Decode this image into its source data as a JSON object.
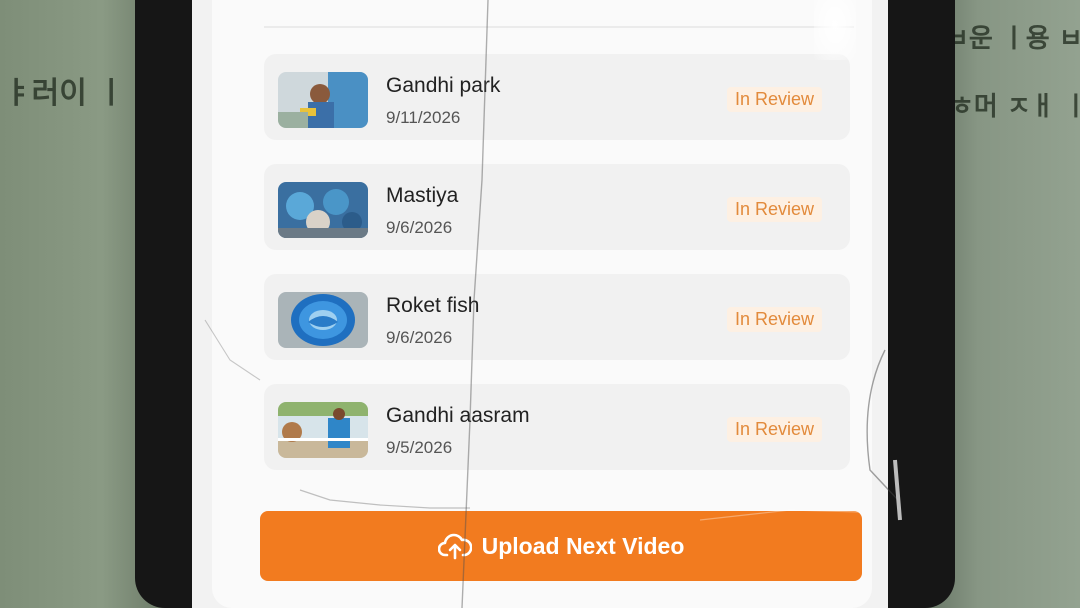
{
  "background": {
    "left_text": "ㅑ러이 ㅣ",
    "right_text_1": "ㅂ운 ㅣ용 ㅂ",
    "right_text_2": "ㅎ머 ㅈㅐ ㅣ"
  },
  "videos": [
    {
      "title": "Gandhi park",
      "date": "9/11/2026",
      "status": "In Review",
      "thumb": "person-photo"
    },
    {
      "title": "Mastiya",
      "date": "9/6/2026",
      "status": "In Review",
      "thumb": "group-photo"
    },
    {
      "title": "Roket fish",
      "date": "9/6/2026",
      "status": "In Review",
      "thumb": "fish-photo"
    },
    {
      "title": "Gandhi aasram",
      "date": "9/5/2026",
      "status": "In Review",
      "thumb": "person-outdoor-photo"
    }
  ],
  "upload_button": {
    "label": "Upload Next Video",
    "icon": "cloud-upload-icon"
  },
  "colors": {
    "accent": "#f27b1f",
    "status": "#e28a3b"
  }
}
